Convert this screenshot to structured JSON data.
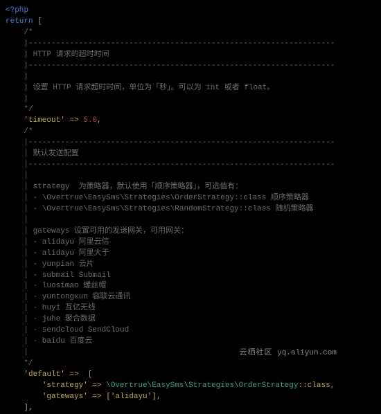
{
  "code": {
    "l1_open": "<?php",
    "l2_return": "return",
    "l2_bracket": " [",
    "c_open": "    /*",
    "c_bar": "    |",
    "c_dash": "    |-------------------------------------------------------------------",
    "c_http_title": "    | HTTP 请求的超时时间",
    "c_http_desc": "    | 设置 HTTP 请求超时时间，单位为「秒」。可以为 int 或者 float。",
    "c_close": "    */",
    "timeout_key": "'timeout'",
    "arrow": " => ",
    "timeout_val": "5.0",
    "comma": ",",
    "c_default_title": "    | 默认发送配置",
    "c_strategy": "    | strategy  为策略器，默认使用「顺序策略器」，可选值有：",
    "c_strategy1": "    | - \\Overtrue\\EasySms\\Strategies\\OrderStrategy::class 顺序策略器",
    "c_strategy2": "    | - \\Overtrue\\EasySms\\Strategies\\RandomStrategy::class 随机策略器",
    "c_gateways": "    | gateways 设置可用的发送网关，可用网关：",
    "c_gw1": "    | - alidayu 阿里云信",
    "c_gw2": "    | - alidayu 阿里大于",
    "c_gw3": "    | - yunpian 云片",
    "c_gw4": "    | - submail Submail",
    "c_gw5": "    | - luosimao 螺丝帽",
    "c_gw6": "    | - yuntongxun 容联云通讯",
    "c_gw7": "    | - huyi 互亿无线",
    "c_gw8": "    | - juhe 聚合数据",
    "c_gw9": "    | - sendcloud SendCloud",
    "c_gw10": "    | - baidu 百度云",
    "default_key": "'default'",
    "default_open": " [",
    "strategy_key": "'strategy'",
    "strategy_ns": "\\Overtrue\\EasySms\\Strategies\\OrderStrategy",
    "strategy_cls": "::class",
    "gateways_key": "'gateways'",
    "gateways_val": "['alidayu']",
    "default_close": "    ],"
  },
  "watermark": {
    "cn": "云栖社区",
    "url": "yq.aliyun.com"
  }
}
